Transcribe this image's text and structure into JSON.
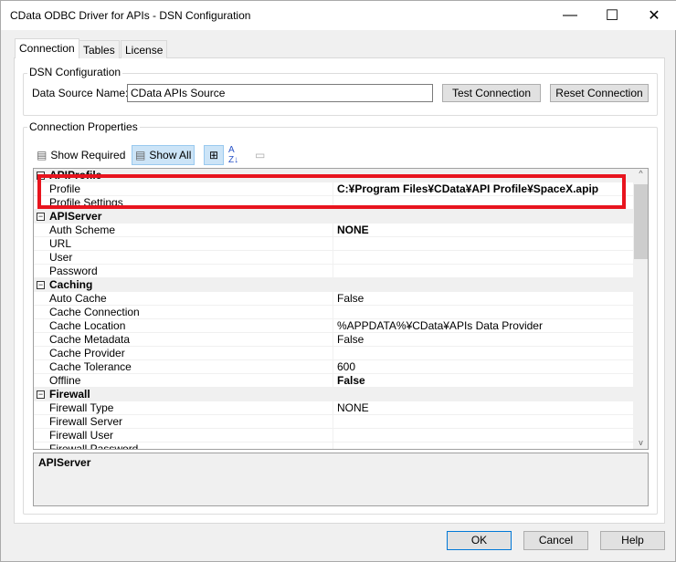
{
  "window": {
    "title": "CData ODBC Driver for APIs - DSN Configuration",
    "minimize": "—",
    "maximize": "☐",
    "close": "✕"
  },
  "tabs": [
    {
      "label": "Connection"
    },
    {
      "label": "Tables"
    },
    {
      "label": "License"
    }
  ],
  "dsn": {
    "group_label": "DSN Configuration",
    "name_label": "Data Source Name:",
    "name_value": "CData APIs Source",
    "test_button": "Test Connection",
    "reset_button": "Reset Connection"
  },
  "props": {
    "group_label": "Connection Properties",
    "show_required": "Show Required",
    "show_all": "Show All"
  },
  "grid": {
    "rows": [
      {
        "type": "cat",
        "name": "APIProfile"
      },
      {
        "name": "Profile",
        "value": "C:¥Program Files¥CData¥API Profile¥SpaceX.apip",
        "bold": true
      },
      {
        "name": "Profile Settings",
        "value": ""
      },
      {
        "type": "cat",
        "name": "APIServer"
      },
      {
        "name": "Auth Scheme",
        "value": "NONE",
        "bold": true
      },
      {
        "name": "URL",
        "value": ""
      },
      {
        "name": "User",
        "value": ""
      },
      {
        "name": "Password",
        "value": ""
      },
      {
        "type": "cat",
        "name": "Caching"
      },
      {
        "name": "Auto Cache",
        "value": "False"
      },
      {
        "name": "Cache Connection",
        "value": ""
      },
      {
        "name": "Cache Location",
        "value": "%APPDATA%¥CData¥APIs Data Provider"
      },
      {
        "name": "Cache Metadata",
        "value": "False"
      },
      {
        "name": "Cache Provider",
        "value": ""
      },
      {
        "name": "Cache Tolerance",
        "value": "600"
      },
      {
        "name": "Offline",
        "value": "False",
        "bold": true
      },
      {
        "type": "cat",
        "name": "Firewall"
      },
      {
        "name": "Firewall Type",
        "value": "NONE"
      },
      {
        "name": "Firewall Server",
        "value": ""
      },
      {
        "name": "Firewall User",
        "value": ""
      },
      {
        "name": "Firewall Password",
        "value": ""
      }
    ]
  },
  "description": {
    "title": "APIServer"
  },
  "buttons": {
    "ok": "OK",
    "cancel": "Cancel",
    "help": "Help"
  }
}
